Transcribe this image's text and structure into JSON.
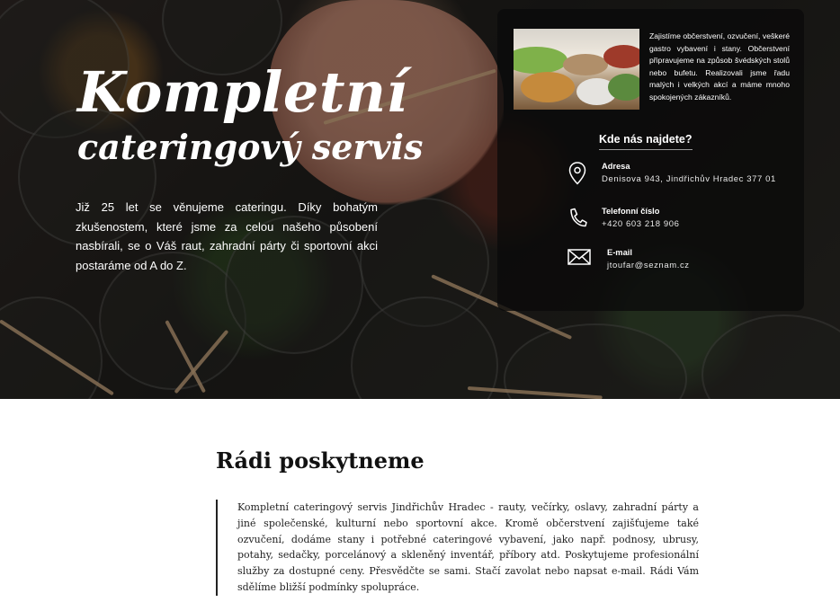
{
  "hero": {
    "title_line1": "Kompletní",
    "title_line2": "cateringový servis",
    "text": "Již 25 let se věnujeme cateringu. Díky bohatým zkušenostem, které jsme za celou našeho působení nasbírali, se o Váš raut, zahradní párty či sportovní akci postaráme od A do Z."
  },
  "panel": {
    "description": "Zajistíme občerstvení, ozvučení, veškeré gastro vybavení i stany. Občerstvení připravujeme na způsob švédských stolů nebo bufetu. Realizovali jsme řadu malých i velkých akcí a máme mnoho spokojených zákazníků.",
    "heading": "Kde nás najdete?",
    "contacts": [
      {
        "icon": "map-pin-icon",
        "label": "Adresa",
        "value": "Denisova 943, Jindřichův Hradec 377 01"
      },
      {
        "icon": "phone-icon",
        "label": "Telefonní číslo",
        "value": "+420 603 218 906"
      },
      {
        "icon": "envelope-icon",
        "label": "E-mail",
        "value": "jtoufar@seznam.cz"
      }
    ]
  },
  "section": {
    "title": "Rádi poskytneme",
    "body": "Kompletní cateringový servis Jindřichův Hradec - rauty, večírky, oslavy, zahradní párty a jiné společenské, kulturní nebo sportovní akce. Kromě občerstvení zajišťujeme také ozvučení, dodáme stany i potřebné cateringové vybavení, jako např. podnosy, ubrusy, potahy, sedačky, porcelánový a skleněný inventář, příbory atd. Poskytujeme profesionální služby za dostupné ceny. Přesvědčte se sami. Stačí zavolat nebo napsat e-mail. Rádi Vám sdělíme bližší podmínky spolupráce."
  },
  "colors": {
    "panel_bg": "#0a0a0a",
    "text_light": "#ffffff",
    "body_text": "#222222"
  }
}
